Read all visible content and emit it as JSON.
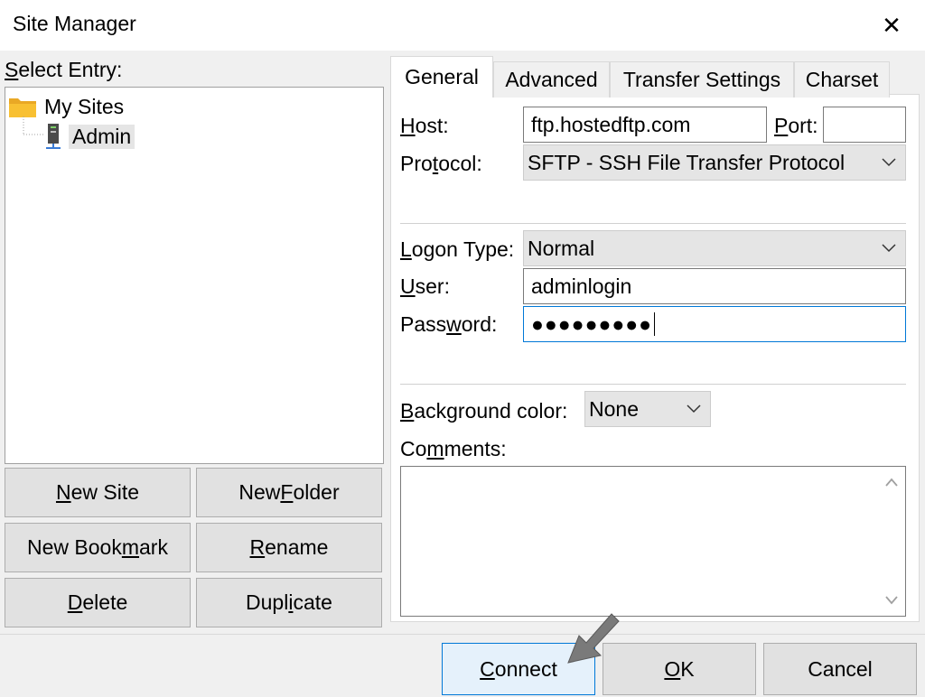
{
  "window": {
    "title": "Site Manager",
    "close_glyph": "✕"
  },
  "left": {
    "select_label_ul": "S",
    "select_label_rest": "elect Entry:",
    "tree": {
      "root": "My Sites",
      "child": "Admin"
    },
    "buttons": {
      "new_site_ul": "N",
      "new_site_rest": "ew Site",
      "new_folder_a": "New ",
      "new_folder_ul": "F",
      "new_folder_b": "older",
      "new_bookmark_a": "New Book",
      "new_bookmark_ul": "m",
      "new_bookmark_b": "ark",
      "rename_ul": "R",
      "rename_rest": "ename",
      "delete_ul": "D",
      "delete_rest": "elete",
      "duplicate_a": "Dupl",
      "duplicate_ul": "i",
      "duplicate_b": "cate"
    }
  },
  "tabs": [
    {
      "label": "General"
    },
    {
      "label": "Advanced"
    },
    {
      "label": "Transfer Settings"
    },
    {
      "label": "Charset"
    }
  ],
  "general": {
    "host_ul": "H",
    "host_rest": "ost:",
    "host_value": "ftp.hostedftp.com",
    "port_ul": "P",
    "port_rest": "ort:",
    "port_value": "",
    "protocol_a": "Pro",
    "protocol_ul": "t",
    "protocol_b": "ocol:",
    "protocol_value": "SFTP - SSH File Transfer Protocol",
    "logon_ul": "L",
    "logon_rest": "ogon Type:",
    "logon_value": "Normal",
    "user_ul": "U",
    "user_rest": "ser:",
    "user_value": "adminlogin",
    "password_a": "Pass",
    "password_ul": "w",
    "password_b": "ord:",
    "password_value": "●●●●●●●●●",
    "bg_ul": "B",
    "bg_rest": "ackground color:",
    "bg_value": "None",
    "comments_a": "Co",
    "comments_ul": "m",
    "comments_b": "ments:"
  },
  "footer": {
    "connect_ul": "C",
    "connect_rest": "onnect",
    "ok_ul": "O",
    "ok_rest": "K",
    "cancel": "Cancel"
  },
  "colors": {
    "accent": "#0078d7",
    "folder": "#f8c032",
    "button_face": "#e1e1e1"
  },
  "icons": {
    "folder": "folder-icon",
    "server": "server-icon",
    "chevron": "chevron-down-icon",
    "scroll_up": "scroll-up-icon",
    "scroll_down": "scroll-down-icon",
    "cursor": "mouse-pointer-icon"
  }
}
